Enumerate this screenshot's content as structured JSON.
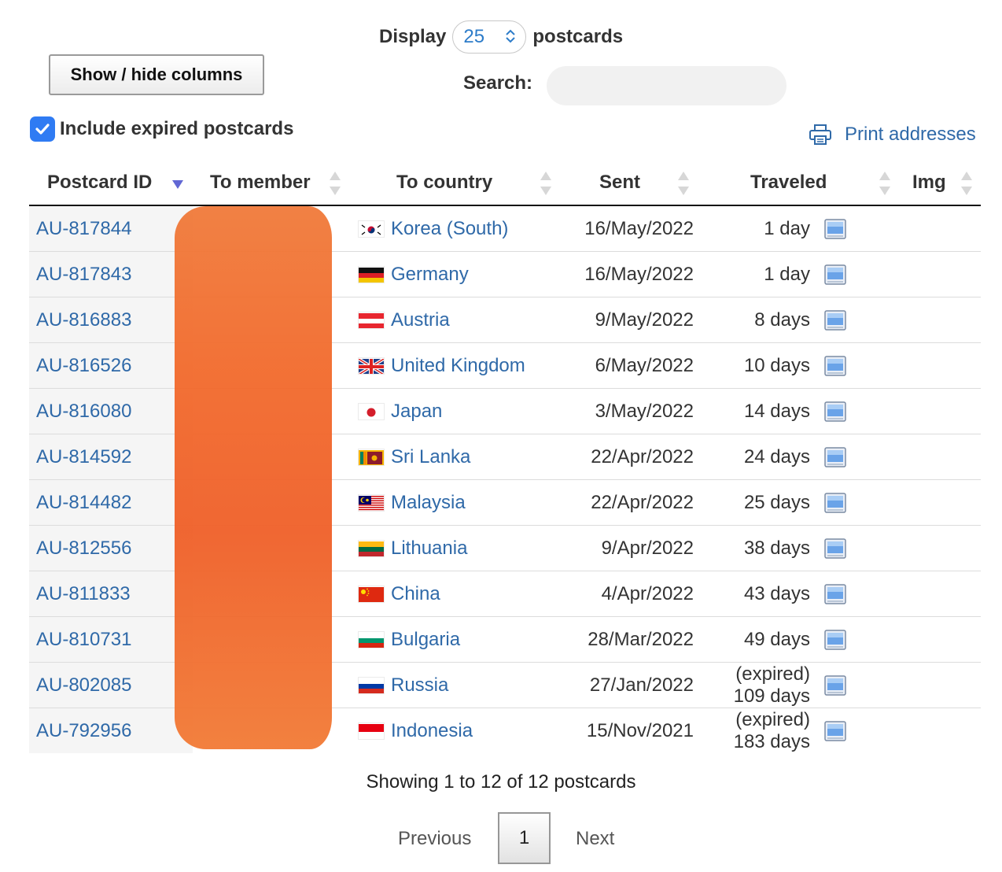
{
  "controls": {
    "display_prefix": "Display",
    "display_value": "25",
    "display_suffix": "postcards",
    "showhide_label": "Show / hide columns",
    "search_label": "Search:",
    "search_value": "",
    "include_expired_label": "Include expired postcards",
    "include_expired_checked": true,
    "print_label": "Print addresses"
  },
  "table": {
    "headers": [
      "Postcard ID",
      "To member",
      "To country",
      "Sent",
      "Traveled",
      "Img"
    ],
    "sorted_column": "Postcard ID",
    "rows": [
      {
        "id": "AU-817844",
        "member": "",
        "country": "Korea (South)",
        "flag": "korea-flag-icon",
        "sent": "16/May/2022",
        "traveled": "1 day"
      },
      {
        "id": "AU-817843",
        "member": "",
        "country": "Germany",
        "flag": "germany-flag-icon",
        "sent": "16/May/2022",
        "traveled": "1 day"
      },
      {
        "id": "AU-816883",
        "member": "",
        "country": "Austria",
        "flag": "austria-flag-icon",
        "sent": "9/May/2022",
        "traveled": "8 days"
      },
      {
        "id": "AU-816526",
        "member": "",
        "country": "United Kingdom",
        "flag": "uk-flag-icon",
        "sent": "6/May/2022",
        "traveled": "10 days"
      },
      {
        "id": "AU-816080",
        "member": "",
        "country": "Japan",
        "flag": "japan-flag-icon",
        "sent": "3/May/2022",
        "traveled": "14 days"
      },
      {
        "id": "AU-814592",
        "member": "",
        "country": "Sri Lanka",
        "flag": "sri-lanka-flag-icon",
        "sent": "22/Apr/2022",
        "traveled": "24 days"
      },
      {
        "id": "AU-814482",
        "member": "",
        "country": "Malaysia",
        "flag": "malaysia-flag-icon",
        "sent": "22/Apr/2022",
        "traveled": "25 days"
      },
      {
        "id": "AU-812556",
        "member": "",
        "country": "Lithuania",
        "flag": "lithuania-flag-icon",
        "sent": "9/Apr/2022",
        "traveled": "38 days"
      },
      {
        "id": "AU-811833",
        "member": "",
        "country": "China",
        "flag": "china-flag-icon",
        "sent": "4/Apr/2022",
        "traveled": "43 days"
      },
      {
        "id": "AU-810731",
        "member": "",
        "country": "Bulgaria",
        "flag": "bulgaria-flag-icon",
        "sent": "28/Mar/2022",
        "traveled": "49 days"
      },
      {
        "id": "AU-802085",
        "member": "",
        "country": "Russia",
        "flag": "russia-flag-icon",
        "sent": "27/Jan/2022",
        "traveled": "(expired) 109 days"
      },
      {
        "id": "AU-792956",
        "member": "",
        "country": "Indonesia",
        "flag": "indonesia-flag-icon",
        "sent": "15/Nov/2021",
        "traveled": "(expired) 183 days"
      }
    ]
  },
  "footer": {
    "info": "Showing 1 to 12 of 12 postcards",
    "previous": "Previous",
    "current_page": "1",
    "next": "Next"
  },
  "colors": {
    "link": "#2f69a8",
    "checkbox": "#2f7bf3",
    "redaction": "#f26a2c"
  }
}
